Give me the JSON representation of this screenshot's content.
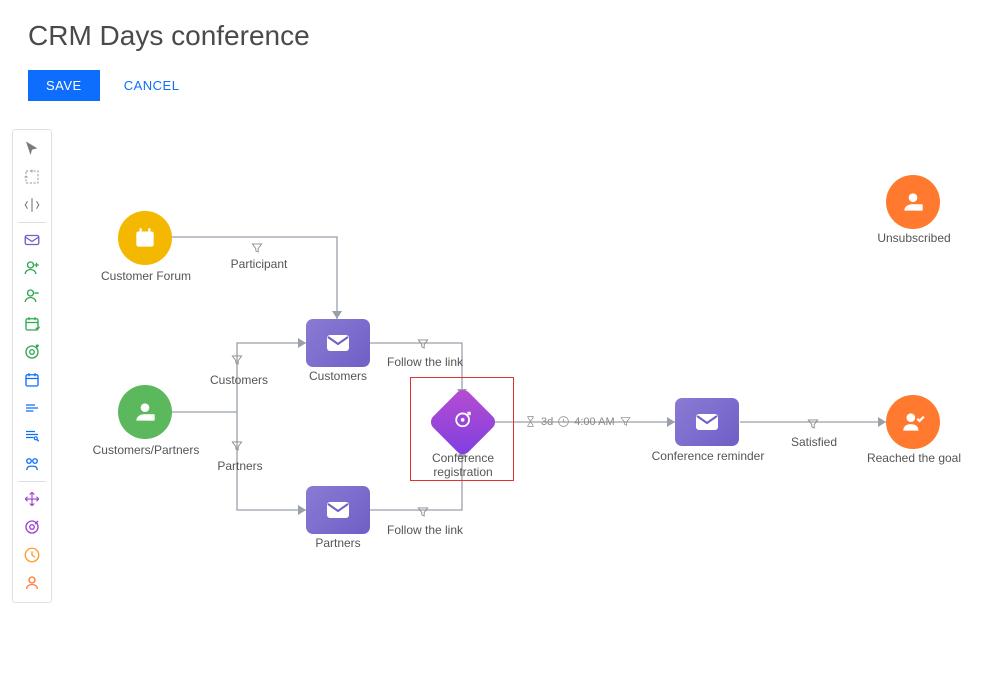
{
  "title": "CRM Days conference",
  "buttons": {
    "save": "SAVE",
    "cancel": "CANCEL"
  },
  "toolbox": {
    "pointer": "pointer-tool",
    "lasso": "lasso-tool",
    "swimlane": "swimlane-tool",
    "email": "email-element",
    "audience_add": "add-audience-element",
    "audience_remove": "remove-audience-element",
    "event": "event-element",
    "landing": "landing-page-element",
    "timer": "timer-element",
    "task": "task-element",
    "feedback": "feedback-element",
    "split": "split-element",
    "move": "move-element",
    "goal": "goal-element",
    "wait": "wait-element",
    "exit": "exit-element"
  },
  "nodes": {
    "customer_forum": "Customer Forum",
    "customers_partners": "Customers/Partners",
    "customers_email": "Customers",
    "partners_email": "Partners",
    "conference_registration": "Conference\nregistration",
    "conference_reminder": "Conference reminder",
    "unsubscribed": "Unsubscribed",
    "reached_goal": "Reached the goal"
  },
  "edges": {
    "participant": "Participant",
    "customers": "Customers",
    "partners": "Partners",
    "follow_link_1": "Follow the link",
    "follow_link_2": "Follow the link",
    "satisfied": "Satisfied"
  },
  "wait": {
    "duration": "3d",
    "time": "4:00 AM"
  }
}
